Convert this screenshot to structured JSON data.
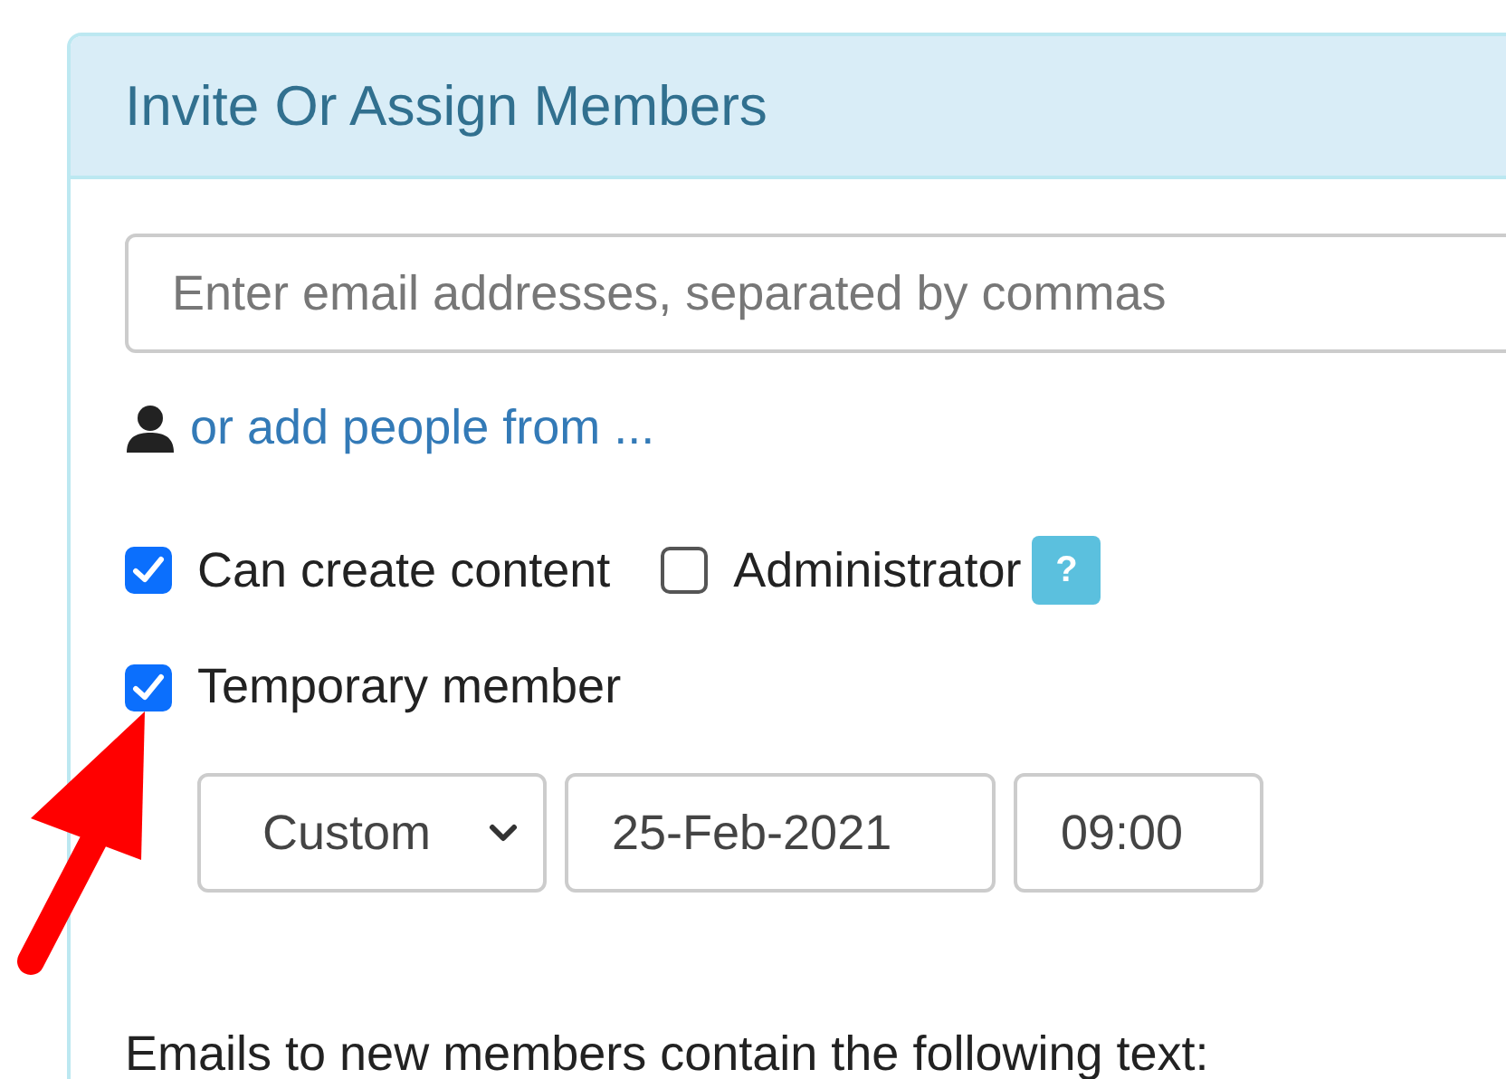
{
  "panel": {
    "title": "Invite Or Assign Members"
  },
  "email_field": {
    "placeholder": "Enter email addresses, separated by commas"
  },
  "add_people_link": "or add people from ...",
  "permissions": [
    {
      "label": "Can create content",
      "checked": true
    },
    {
      "label": "Administrator",
      "checked": false,
      "help_badge": "?"
    }
  ],
  "temporary": {
    "label": "Temporary member",
    "checked": true
  },
  "expiry": {
    "period": "Custom",
    "date": "25-Feb-2021",
    "time": "09:00"
  },
  "email_text_label": "Emails to new members contain the following text:"
}
